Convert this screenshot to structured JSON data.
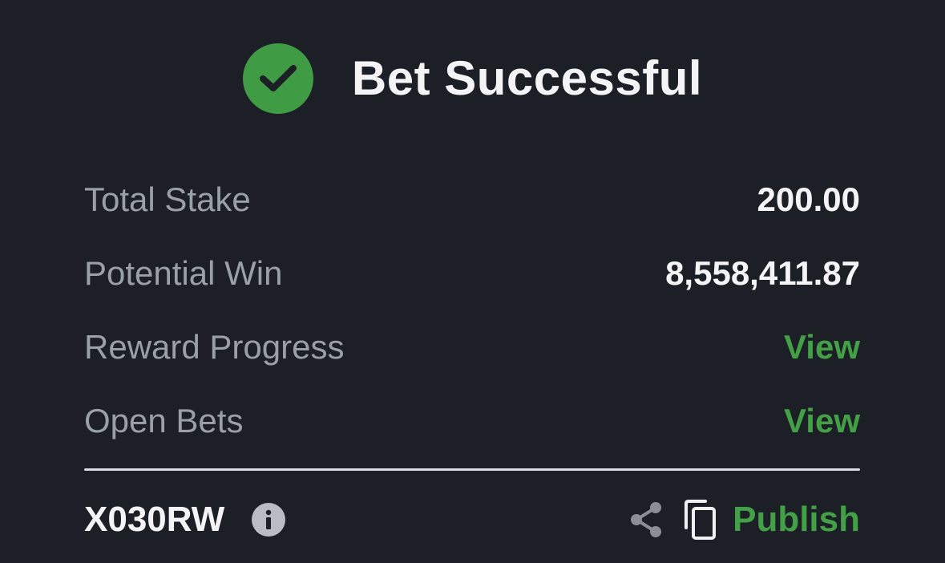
{
  "header": {
    "title": "Bet Successful",
    "icon": "check-circle-icon",
    "accent_color": "#3f9b44"
  },
  "summary": {
    "rows": [
      {
        "label": "Total Stake",
        "value": "200.00"
      },
      {
        "label": "Potential Win",
        "value": "8,558,411.87"
      },
      {
        "label": "Reward Progress",
        "link": "View"
      },
      {
        "label": "Open Bets",
        "link": "View"
      }
    ]
  },
  "footer": {
    "booking_code": "X030RW",
    "info_icon": "info-icon",
    "share_icon": "share-icon",
    "copy_icon": "copy-icon",
    "publish_label": "Publish",
    "link_color": "#43a047"
  }
}
